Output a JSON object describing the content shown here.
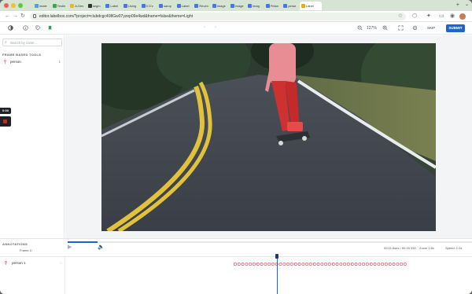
{
  "browser": {
    "tabs": [
      {
        "label": "imate",
        "color": "#4aa3df"
      },
      {
        "label": "Testin",
        "color": "#3aa757"
      },
      {
        "label": "A-Dev",
        "color": "#e8b339"
      },
      {
        "label": "segm",
        "color": "#333333"
      },
      {
        "label": "Label",
        "color": "#4a74e8"
      },
      {
        "label": "Using",
        "color": "#4a74e8"
      },
      {
        "label": "5 G'z",
        "color": "#4a74e8"
      },
      {
        "label": "samp",
        "color": "#4a74e8"
      },
      {
        "label": "Label",
        "color": "#4a74e8"
      },
      {
        "label": "Reven",
        "color": "#4a74e8"
      },
      {
        "label": "image",
        "color": "#4a74e8"
      },
      {
        "label": "Image",
        "color": "#4a74e8"
      },
      {
        "label": "imag",
        "color": "#4a74e8"
      },
      {
        "label": "Pelan",
        "color": "#4a74e8"
      },
      {
        "label": "perse",
        "color": "#4a74e8"
      },
      {
        "label": "Label",
        "color": "#f2a900",
        "active": true
      }
    ],
    "url": "editor.labelbox.com/?project=clubdcgc408Gw07yzep09e4wd&frame=false&theme=Light",
    "back_icon": "arrow-left-icon",
    "forward_icon": "arrow-right-icon",
    "reload_icon": "reload-icon"
  },
  "app": {
    "zoom": "127%",
    "skip_label": "SKIP",
    "submit_label": "SUBMIT",
    "accent": "#1e63d6"
  },
  "left_panel": {
    "search_placeholder": "Search by name...",
    "section_title": "FRAME BASED TOOLS",
    "tools": [
      {
        "label": "person",
        "hotkey": "1",
        "color": "#e0606b"
      }
    ],
    "time_badge": "0:00"
  },
  "bottom_panel": {
    "annotations_title": "ANNOTATIONS",
    "frames_label": "Frame 1/",
    "time_readout": "00:01.8sec / 00:20.330",
    "zoom_label": "Zoom 2.8x",
    "speed_label": "Speed: 1.0x",
    "tracks": [
      {
        "label": "person 1",
        "color": "#e0606b"
      }
    ],
    "keyframe_color": "#e0606b"
  }
}
